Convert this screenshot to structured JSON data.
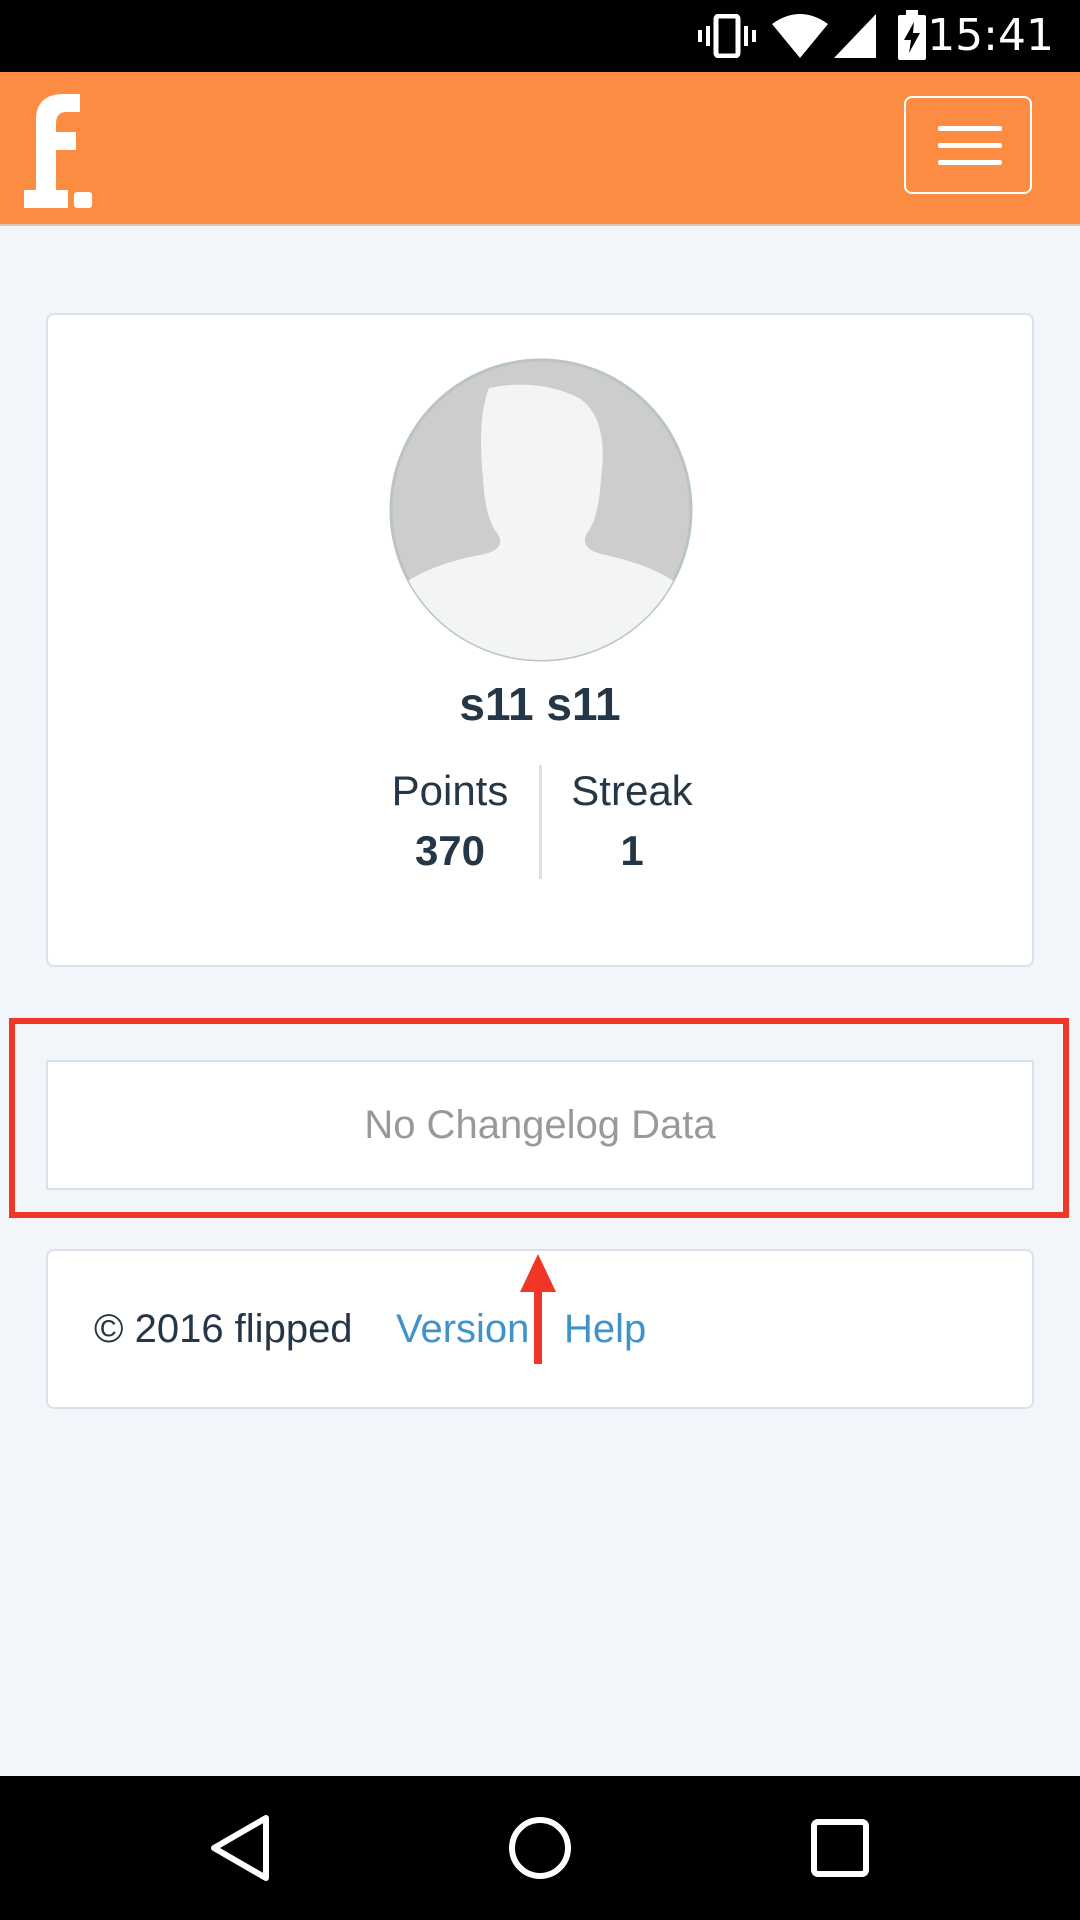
{
  "status_bar": {
    "time": "15:41",
    "icons": [
      "vibrate-icon",
      "wifi-icon",
      "signal-icon",
      "battery-charging-icon"
    ]
  },
  "app_bar": {
    "logo_text": "f.",
    "menu_icon": "hamburger-menu-icon",
    "colors": {
      "background": "#fd8c43"
    }
  },
  "profile": {
    "avatar_icon": "default-avatar-icon",
    "name": "s11 s11",
    "stats": [
      {
        "label": "Points",
        "value": "370"
      },
      {
        "label": "Streak",
        "value": "1"
      }
    ]
  },
  "changelog": {
    "message": "No Changelog Data",
    "highlight_color": "#f03625"
  },
  "footer": {
    "copyright": "© 2016 flipped",
    "links": [
      {
        "label": "Version"
      },
      {
        "label": "Help"
      }
    ],
    "link_color": "#3f93c9"
  },
  "annotation": {
    "arrow_icon": "up-arrow-icon",
    "color": "#f03625"
  },
  "nav_bar": {
    "buttons": [
      "back-icon",
      "home-icon",
      "recents-icon"
    ]
  }
}
